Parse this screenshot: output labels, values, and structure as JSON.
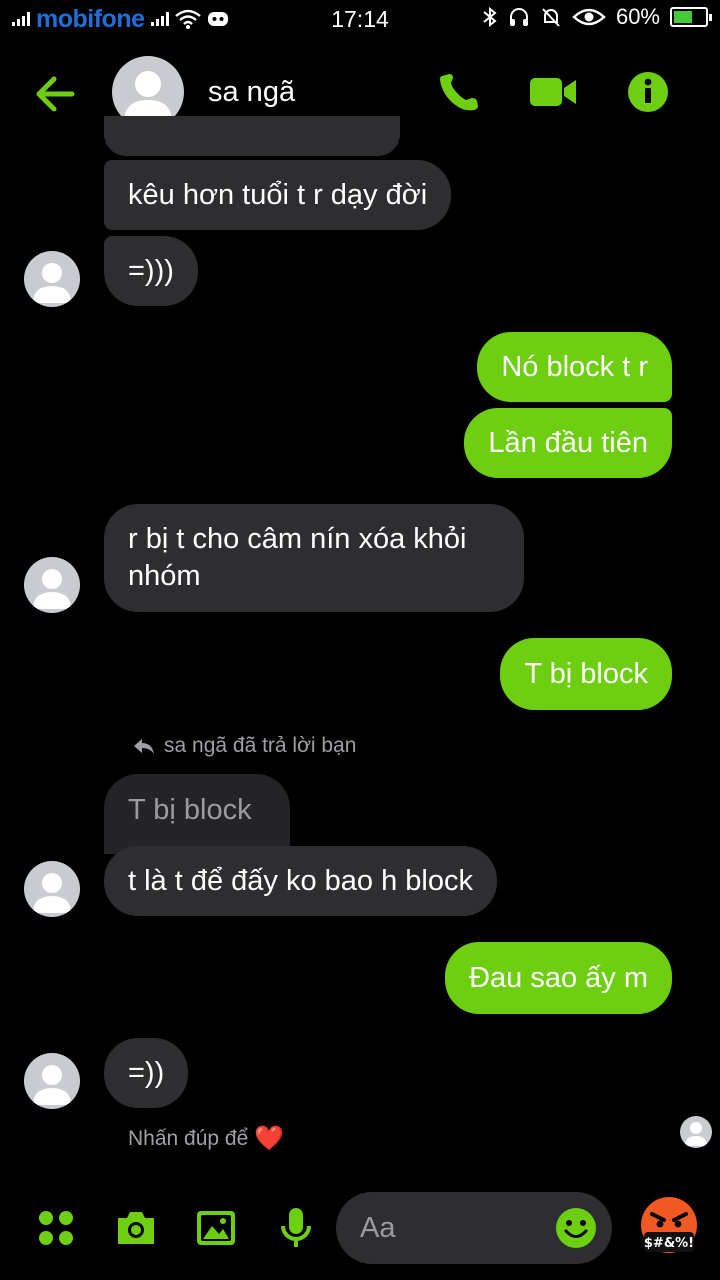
{
  "status_bar": {
    "carrier": "mobifone",
    "time": "17:14",
    "battery": "60%",
    "battery_level": 0.6
  },
  "header": {
    "contact_name": "sa ngã"
  },
  "messages": {
    "m1": "kêu hơn tuổi t r dạy đời",
    "m2": "=)))",
    "m3": "Nó block t r",
    "m4": "Lần đầu tiên",
    "m5_line1": "r bị t cho câm nín xóa khỏi",
    "m5_line2": "nhóm",
    "m6": "T bị block",
    "reply_note": "sa ngã đã trả lời bạn",
    "quoted": "T bị block",
    "m7": "t là t để đấy ko bao h block",
    "m8": "Đau sao ấy m",
    "m9": "=))"
  },
  "hint": {
    "text": "Nhấn đúp để",
    "heart": "❤️"
  },
  "composer": {
    "placeholder": "Aa",
    "reaction_text": "$#&%!"
  },
  "colors": {
    "accent": "#6dce12",
    "incoming_bubble": "#2e2e30",
    "background": "#000000"
  },
  "icons": [
    "back-arrow-icon",
    "phone-icon",
    "video-camera-icon",
    "info-icon",
    "apps-icon",
    "camera-icon",
    "image-icon",
    "microphone-icon",
    "emoji-icon",
    "angry-face-icon",
    "reply-arrow-icon"
  ]
}
